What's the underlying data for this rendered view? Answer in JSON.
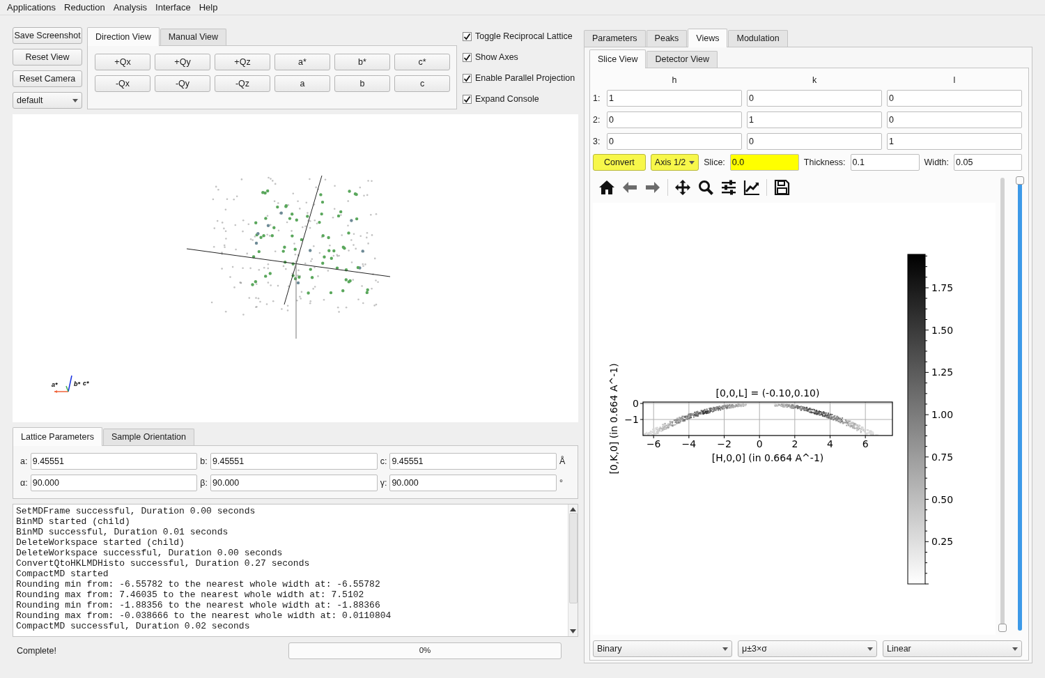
{
  "menu": [
    "Applications",
    "Reduction",
    "Analysis",
    "Interface",
    "Help"
  ],
  "view_buttons": [
    "Save Screenshot",
    "Reset View",
    "Reset Camera"
  ],
  "camera_combo": {
    "value": "default"
  },
  "view_tabs": [
    {
      "label": "Direction View",
      "selected": true
    },
    {
      "label": "Manual View",
      "selected": false
    }
  ],
  "direction_buttons": [
    [
      "+Qx",
      "+Qy",
      "+Qz",
      "a*",
      "b*",
      "c*"
    ],
    [
      "-Qx",
      "-Qy",
      "-Qz",
      "a",
      "b",
      "c"
    ]
  ],
  "options": [
    {
      "label": "Toggle Reciprocal Lattice",
      "checked": true
    },
    {
      "label": "Show Axes",
      "checked": true
    },
    {
      "label": "Enable Parallel Projection",
      "checked": true
    },
    {
      "label": "Expand Console",
      "checked": true
    }
  ],
  "triad_labels": [
    "a*",
    "b*",
    "c*"
  ],
  "lattice_tabs": [
    {
      "label": "Lattice Parameters",
      "selected": true
    },
    {
      "label": "Sample Orientation",
      "selected": false
    }
  ],
  "lattice_rows": [
    {
      "fields": [
        {
          "label": "a:",
          "value": "9.45551"
        },
        {
          "label": "b:",
          "value": "9.45551"
        },
        {
          "label": "c:",
          "value": "9.45551"
        }
      ],
      "unit": "Å"
    },
    {
      "fields": [
        {
          "label": "α:",
          "value": "90.000"
        },
        {
          "label": "β:",
          "value": "90.000"
        },
        {
          "label": "γ:",
          "value": "90.000"
        }
      ],
      "unit": "°"
    }
  ],
  "console_lines": [
    "SetMDFrame successful, Duration 0.00 seconds",
    "BinMD started (child)",
    "BinMD successful, Duration 0.01 seconds",
    "DeleteWorkspace started (child)",
    "DeleteWorkspace successful, Duration 0.00 seconds",
    "ConvertQtoHKLMDHisto successful, Duration 0.27 seconds",
    "CompactMD started",
    "Rounding min from: -6.55782 to the nearest whole width at: -6.55782",
    "Rounding max from: 7.46035 to the nearest whole width at: 7.5102",
    "Rounding min from: -1.88356 to the nearest whole width at: -1.88366",
    "Rounding max from: -0.038666 to the nearest whole width at: 0.0110804",
    "CompactMD successful, Duration 0.02 seconds"
  ],
  "status": "Complete!",
  "progress": {
    "text": "0%",
    "level": 0
  },
  "main_tabs": [
    {
      "label": "Parameters",
      "selected": false
    },
    {
      "label": "Peaks",
      "selected": false
    },
    {
      "label": "Views",
      "selected": true
    },
    {
      "label": "Modulation",
      "selected": false
    }
  ],
  "view_subtabs": [
    {
      "label": "Slice View",
      "selected": true
    },
    {
      "label": "Detector View",
      "selected": false
    }
  ],
  "projection": {
    "columns": [
      "h",
      "k",
      "l"
    ],
    "rows": [
      {
        "label": "1:",
        "values": [
          "1",
          "0",
          "0"
        ]
      },
      {
        "label": "2:",
        "values": [
          "0",
          "1",
          "0"
        ]
      },
      {
        "label": "3:",
        "values": [
          "0",
          "0",
          "1"
        ]
      }
    ]
  },
  "slice_controls": {
    "convert": {
      "label": "Convert",
      "highlighted": true
    },
    "axis_combo": {
      "value": "Axis 1/2",
      "highlighted": true
    },
    "fields": [
      {
        "label": "Slice:",
        "value": "0.0",
        "highlighted": true
      },
      {
        "label": "Thickness:",
        "value": "0.1",
        "highlighted": false
      },
      {
        "label": "Width:",
        "value": "0.05",
        "highlighted": false
      }
    ]
  },
  "toolbar": [
    {
      "kind": "home",
      "disabled": false
    },
    {
      "kind": "back",
      "disabled": true
    },
    {
      "kind": "forward",
      "disabled": true
    },
    {
      "kind": "separator"
    },
    {
      "kind": "pan",
      "disabled": false
    },
    {
      "kind": "zoom",
      "disabled": false
    },
    {
      "kind": "configure",
      "disabled": false
    },
    {
      "kind": "edit",
      "disabled": false
    },
    {
      "kind": "separator"
    },
    {
      "kind": "save",
      "disabled": false
    }
  ],
  "slice_plot": {
    "title": "[0,0,L] = (-0.10,0.10)",
    "xlabel": "[H,0,0] (in 0.664 A^-1)",
    "ylabel": "[0,K,0] (in 0.664 A^-1)",
    "xticks": [
      "−6",
      "−4",
      "−2",
      "0",
      "2",
      "4",
      "6"
    ],
    "yticks": [
      "0",
      "−1"
    ],
    "colorbar_ticks": [
      "1.75",
      "1.50",
      "1.25",
      "1.00",
      "0.75",
      "0.50",
      "0.25"
    ]
  },
  "range_sliders": [
    {
      "level": 0
    },
    {
      "level": 1
    }
  ],
  "bottom_combos": [
    {
      "value": "Binary"
    },
    {
      "value": "μ±3×σ"
    },
    {
      "value": "Linear"
    }
  ]
}
